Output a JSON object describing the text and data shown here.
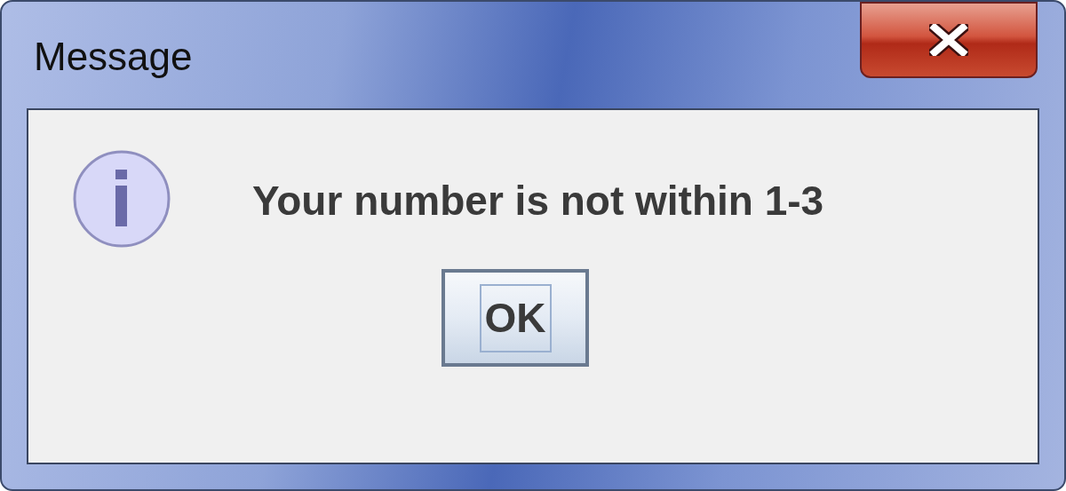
{
  "window": {
    "title": "Message"
  },
  "message": {
    "text": "Your number is not within 1-3"
  },
  "buttons": [
    {
      "label": "OK",
      "focused": true
    }
  ]
}
